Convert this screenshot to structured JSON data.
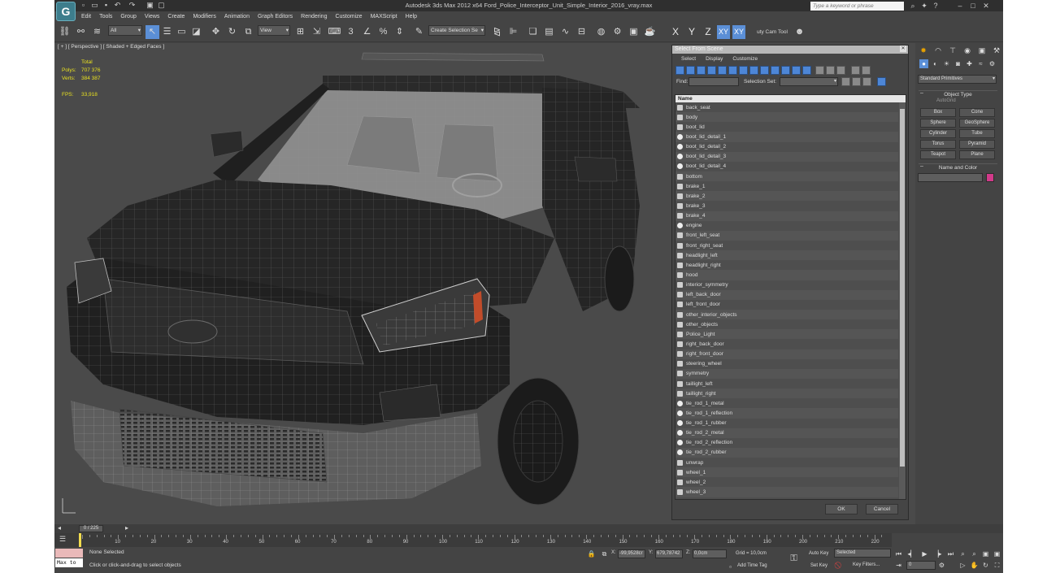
{
  "window": {
    "title": "Autodesk 3ds Max  2012 x64     Ford_Police_Interceptor_Unit_Simple_Interior_2016_vray.max",
    "search_placeholder": "Type a keyword or phrase"
  },
  "menubar": [
    "Edit",
    "Tools",
    "Group",
    "Views",
    "Create",
    "Modifiers",
    "Animation",
    "Graph Editors",
    "Rendering",
    "Customize",
    "MAXScript",
    "Help"
  ],
  "toolbar": {
    "selection_filter": "All",
    "reference_coord": "View",
    "named_selection": "Create Selection Se",
    "axes": [
      "X",
      "Y",
      "Z",
      "XY",
      "XY"
    ],
    "utility_cam": "uty Cam Tool"
  },
  "viewport": {
    "label": "[ + ] [ Perspective ] [ Shaded + Edged Faces ]",
    "stats_header": "Total",
    "polys_label": "Polys:",
    "polys_value": "707 376",
    "verts_label": "Verts:",
    "verts_value": "384 387",
    "fps_label": "FPS:",
    "fps_value": "33,918"
  },
  "select_dialog": {
    "title": "Select From Scene",
    "menu": [
      "Select",
      "Display",
      "Customize"
    ],
    "find_label": "Find:",
    "selection_set_label": "Selection Set:",
    "column_name": "Name",
    "objects": [
      "back_seat",
      "body",
      "boot_lid",
      "boot_lid_detail_1",
      "boot_lid_detail_2",
      "boot_lid_detail_3",
      "boot_lid_detail_4",
      "bottom",
      "brake_1",
      "brake_2",
      "brake_3",
      "brake_4",
      "engine",
      "front_left_seat",
      "front_right_seat",
      "headlight_left",
      "headlight_right",
      "hood",
      "interior_symmetry",
      "left_back_door",
      "left_front_door",
      "other_interior_objects",
      "other_objects",
      "Police_Light",
      "right_back_door",
      "right_front_door",
      "steering_wheel",
      "symmetry",
      "taillight_left",
      "taillight_right",
      "tie_rod_1_metal",
      "tie_rod_1_reflection",
      "tie_rod_1_rubber",
      "tie_rod_2_metal",
      "tie_rod_2_reflection",
      "tie_rod_2_rubber",
      "unwrap",
      "wheel_1",
      "wheel_2",
      "wheel_3"
    ],
    "ok_label": "OK",
    "cancel_label": "Cancel"
  },
  "command_panel": {
    "category": "Standard Primitives",
    "object_type_title": "Object Type",
    "autogrid_label": "AutoGrid",
    "primitives": [
      "Box",
      "Cone",
      "Sphere",
      "GeoSphere",
      "Cylinder",
      "Tube",
      "Torus",
      "Pyramid",
      "Teapot",
      "Plane"
    ],
    "name_color_title": "Name and Color",
    "swatch_color": "#d23a8a"
  },
  "timeline": {
    "frame_counter": "0 / 225",
    "ruler_labels": [
      "0",
      "10",
      "20",
      "30",
      "40",
      "50",
      "60",
      "70",
      "80",
      "90",
      "100",
      "110",
      "120",
      "130",
      "140",
      "150",
      "160",
      "170",
      "180",
      "190",
      "200",
      "210",
      "220"
    ]
  },
  "status": {
    "maxscript_label": "Max to",
    "selection_text": "None Selected",
    "prompt_text": "Click or click-and-drag to select objects",
    "x_value": "-99,9528cr",
    "y_value": "679,78742",
    "z_value": "0,0cm",
    "grid_text": "Grid = 10,0cm",
    "add_time_tag": "Add Time Tag",
    "auto_key": "Auto Key",
    "set_key": "Set Key",
    "selected_dropdown": "Selected",
    "key_filters": "Key Filters...",
    "frame_field": "0"
  }
}
